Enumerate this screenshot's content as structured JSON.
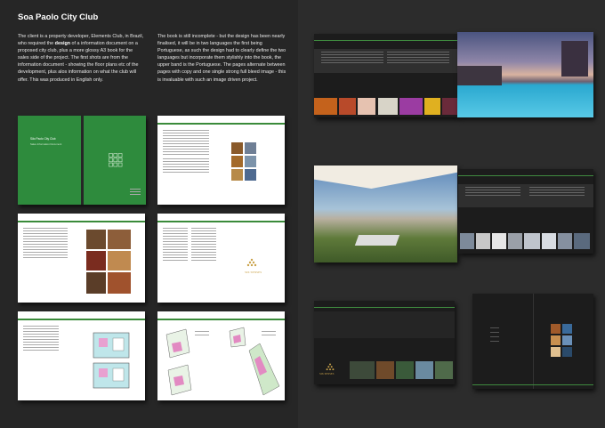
{
  "header": {
    "title": "Soa Paolo City Club"
  },
  "intro": {
    "col1_before": "The client is a property developer, Elements Club, in Brazil, who required the ",
    "col1_bold": "design",
    "col1_after": " of a information document on a proposed city club, plus a more glossy A3 book for the sales side of the project. The first shots are from the information document - showing the floor plans etc of the development, plus alos information on what the club will offer. This was produced in English only.",
    "col2": "The book is still incomplete - but the design has been nearly finalised, it will be in two languages the first being Portuguese, as such the design had to clearly define the two languages but incorporate them stylishly into the book, the upper band is the Portuguese. The pages alternate between pages with copy and one single strong full bleed image - this is invaluable with such an image driven project."
  },
  "cover": {
    "title": "São Paolo City Club",
    "subtitle": "Sales Information Document"
  },
  "logo": {
    "name": "SIX SENSES",
    "tagline": "HOTELS · RESORTS · SPAS"
  },
  "colors": {
    "left_bg": "#262626",
    "right_bg": "#2c2c2c",
    "brand_green": "#2e8b3d",
    "gold": "#c9a24a"
  }
}
